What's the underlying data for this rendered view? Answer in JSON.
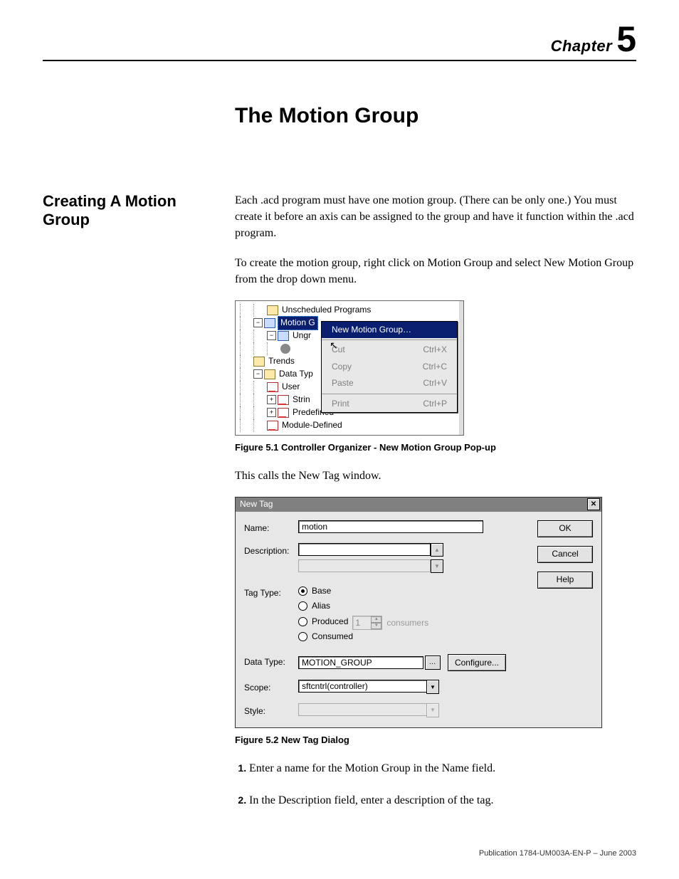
{
  "chapter": {
    "label": "Chapter",
    "number": "5",
    "title": "The Motion Group"
  },
  "section": {
    "heading": "Creating A Motion Group"
  },
  "body": {
    "p1": "Each .acd program must have one motion group. (There can be only one.) You must create it before an axis can be assigned to the group and have it function within the .acd program.",
    "p2": "To create the motion group, right click on Motion Group and select New Motion Group from the drop down menu.",
    "fig1_caption": "Figure 5.1 Controller Organizer - New Motion Group Pop-up",
    "p3": "This calls the New Tag window.",
    "fig2_caption": "Figure 5.2 New Tag Dialog",
    "step1": "Enter a name for the Motion Group in the Name field.",
    "step2": "In the Description field, enter a description of the tag.",
    "step1_num": "1.",
    "step2_num": "2."
  },
  "fig1": {
    "tree": {
      "unscheduled": "Unscheduled Programs",
      "motion_group": "Motion G",
      "ungrouped": "Ungr",
      "trends": "Trends",
      "data_types": "Data Typ",
      "user": "User",
      "strings": "Strin",
      "predefined": "Predefined",
      "module_defined": "Module-Defined"
    },
    "menu": {
      "new_motion_group": "New Motion Group…",
      "cut": "Cut",
      "cut_sc": "Ctrl+X",
      "copy": "Copy",
      "copy_sc": "Ctrl+C",
      "paste": "Paste",
      "paste_sc": "Ctrl+V",
      "print": "Print",
      "print_sc": "Ctrl+P"
    }
  },
  "dlg": {
    "title": "New Tag",
    "labels": {
      "name": "Name:",
      "description": "Description:",
      "tag_type": "Tag Type:",
      "data_type": "Data Type:",
      "scope": "Scope:",
      "style": "Style:"
    },
    "name_value": "motion",
    "tag_types": {
      "base": "Base",
      "alias": "Alias",
      "produced": "Produced",
      "consumed": "Consumed"
    },
    "produced_count": "1",
    "consumers_label": "consumers",
    "data_type_value": "MOTION_GROUP",
    "scope_value": "sftcntrl(controller)",
    "style_value": "",
    "buttons": {
      "ok": "OK",
      "cancel": "Cancel",
      "help": "Help",
      "configure": "Configure..."
    }
  },
  "footer": "Publication 1784-UM003A-EN-P – June 2003"
}
